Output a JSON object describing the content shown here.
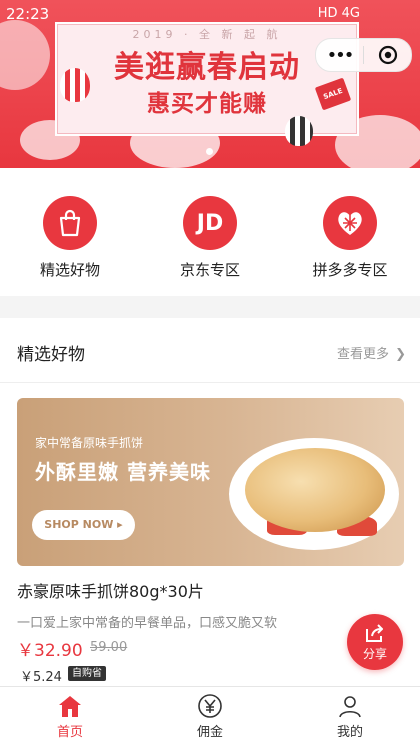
{
  "status_bar": {
    "time": "22:23",
    "indicators": "HD 4G"
  },
  "banner": {
    "year_text": "2019 · 全 新 起 航",
    "title": "美逛赢春启动",
    "subtitle": "惠买才能赚",
    "tag": "SALE"
  },
  "capsule": {
    "more_label": "•••"
  },
  "categories": [
    {
      "label": "精选好物",
      "icon": "shopping-bag-icon",
      "color": "#e8373f"
    },
    {
      "label": "京东专区",
      "icon": "jd-logo-icon",
      "icon_text": "JD",
      "color": "#e8373f"
    },
    {
      "label": "拼多多专区",
      "icon": "pinduoduo-logo-icon",
      "color": "#e8373f"
    }
  ],
  "section": {
    "title": "精选好物",
    "more_label": "查看更多"
  },
  "product_banner": {
    "subtitle": "家中常备原味手抓饼",
    "title": "外酥里嫩 营养美味",
    "button_label": "SHOP NOW ▸"
  },
  "product": {
    "name": "赤豪原味手抓饼80g*30片",
    "description": "一口爱上家中常备的早餐单品，口感又脆又软",
    "price": "￥32.90",
    "original_price": "59.00",
    "commission": "￥5.24",
    "badge": "自购省"
  },
  "share": {
    "label": "分享"
  },
  "tabs": [
    {
      "label": "首页",
      "icon": "home-icon",
      "active": true
    },
    {
      "label": "佣金",
      "icon": "yen-icon",
      "active": false
    },
    {
      "label": "我的",
      "icon": "user-icon",
      "active": false
    }
  ],
  "colors": {
    "accent": "#e8373f",
    "gray_text": "#999999"
  }
}
